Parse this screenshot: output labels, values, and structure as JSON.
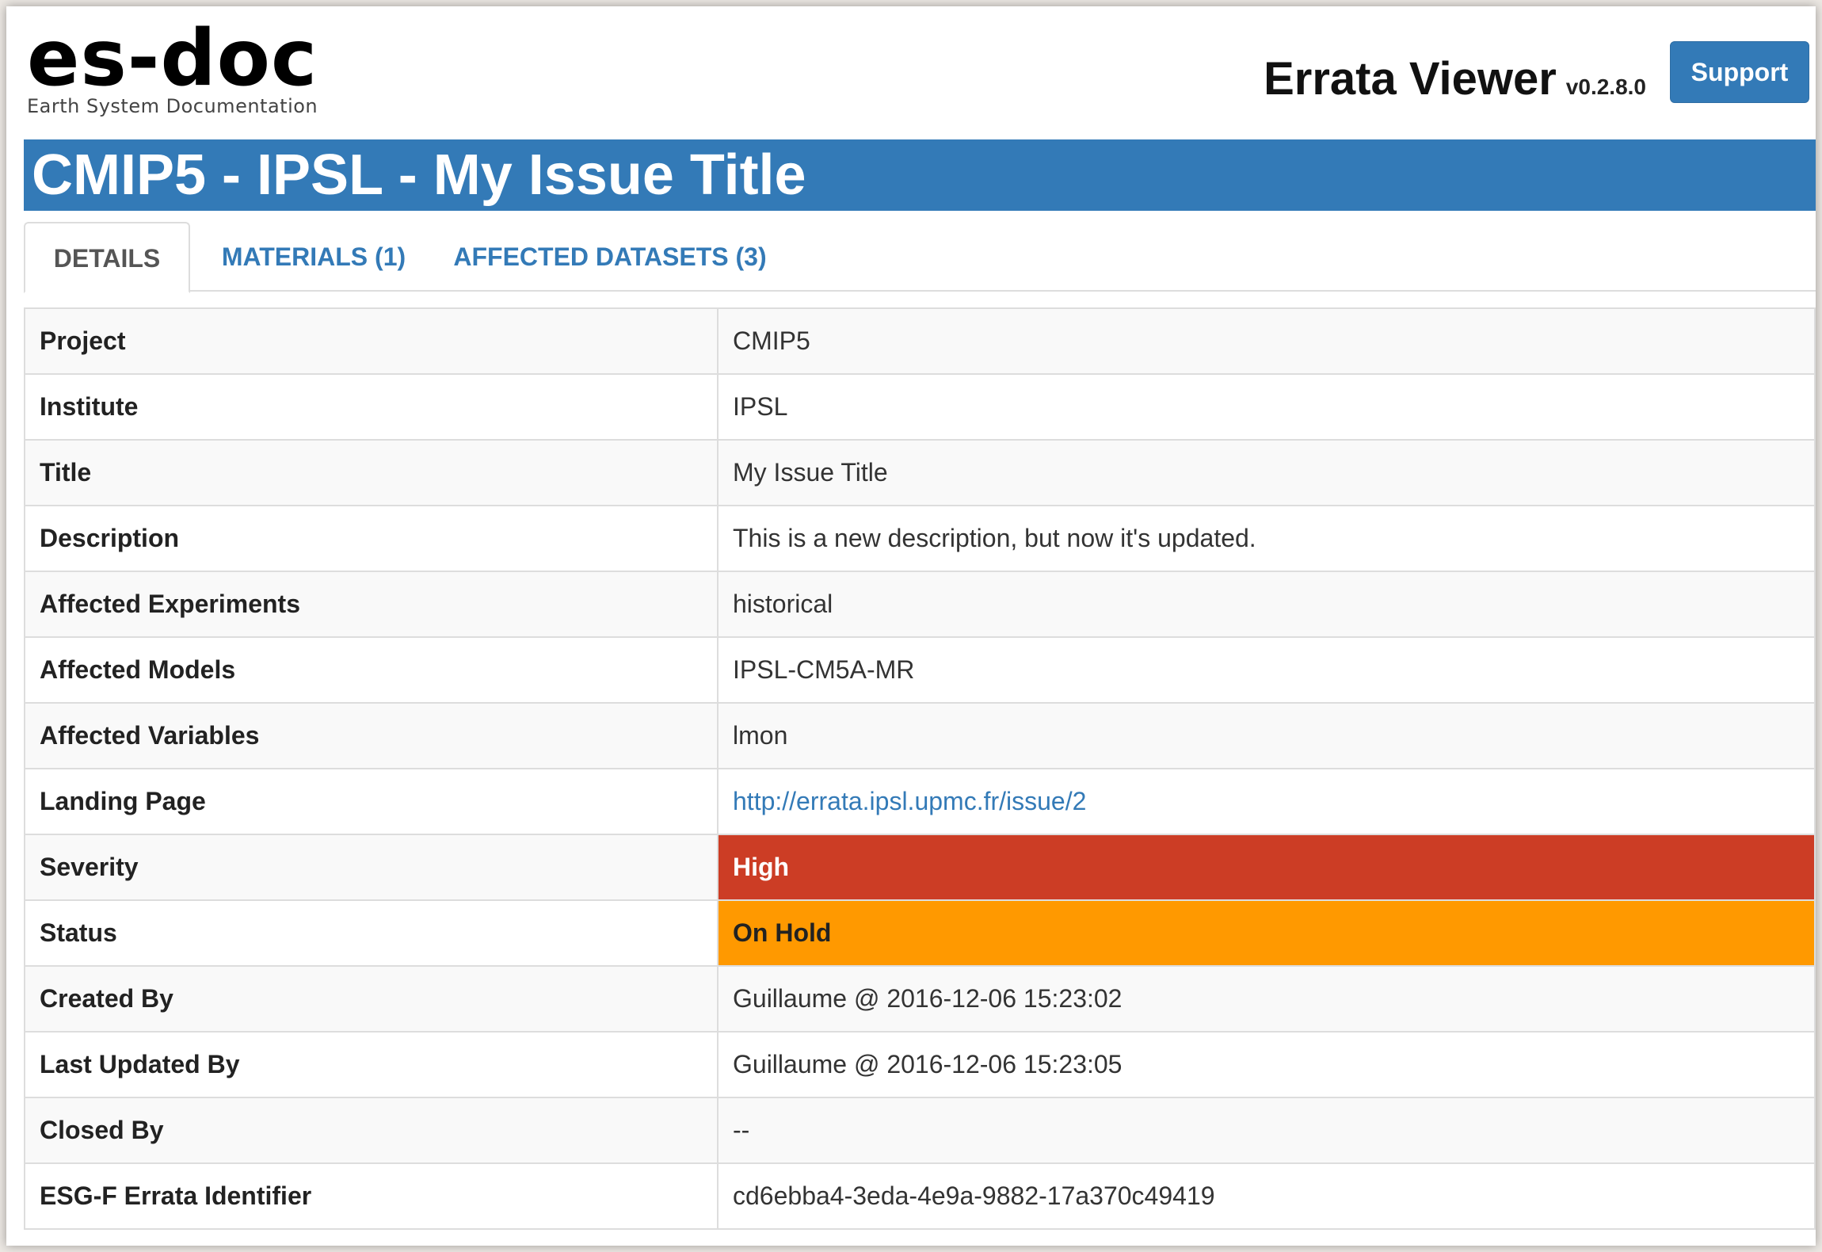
{
  "header": {
    "logo_text": "es-doc",
    "logo_subtitle": "Earth System Documentation",
    "app_name": "Errata Viewer",
    "app_version": "v0.2.8.0",
    "support_label": "Support"
  },
  "page_title": "CMIP5 - IPSL - My Issue Title",
  "tabs": [
    {
      "label": "DETAILS",
      "active": true
    },
    {
      "label": "MATERIALS (1)",
      "active": false
    },
    {
      "label": "AFFECTED DATASETS (3)",
      "active": false
    }
  ],
  "details": [
    {
      "label": "Project",
      "value": "CMIP5"
    },
    {
      "label": "Institute",
      "value": "IPSL"
    },
    {
      "label": "Title",
      "value": "My Issue Title"
    },
    {
      "label": "Description",
      "value": "This is a new description, but now it's updated."
    },
    {
      "label": "Affected Experiments",
      "value": "historical"
    },
    {
      "label": "Affected Models",
      "value": "IPSL-CM5A-MR"
    },
    {
      "label": "Affected Variables",
      "value": "lmon"
    },
    {
      "label": "Landing Page",
      "value": "http://errata.ipsl.upmc.fr/issue/2"
    },
    {
      "label": "Severity",
      "value": "High"
    },
    {
      "label": "Status",
      "value": "On Hold"
    },
    {
      "label": "Created By",
      "value": "Guillaume @ 2016-12-06 15:23:02"
    },
    {
      "label": "Last Updated By",
      "value": "Guillaume @ 2016-12-06 15:23:05"
    },
    {
      "label": "Closed By",
      "value": "--"
    },
    {
      "label": "ESG-F Errata Identifier",
      "value": "cd6ebba4-3eda-4e9a-9882-17a370c49419"
    }
  ],
  "colors": {
    "primary": "#337ab7",
    "severity_high": "#cc3d25",
    "status_on_hold": "#ff9900"
  }
}
